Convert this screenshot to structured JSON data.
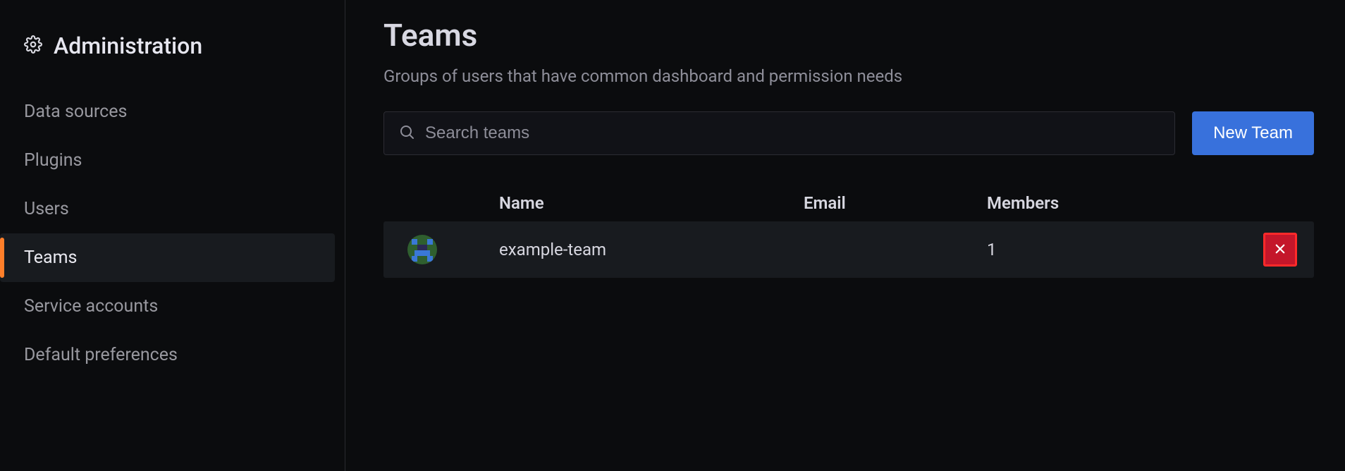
{
  "sidebar": {
    "title": "Administration",
    "items": [
      {
        "label": "Data sources",
        "active": false
      },
      {
        "label": "Plugins",
        "active": false
      },
      {
        "label": "Users",
        "active": false
      },
      {
        "label": "Teams",
        "active": true
      },
      {
        "label": "Service accounts",
        "active": false
      },
      {
        "label": "Default preferences",
        "active": false
      }
    ]
  },
  "page": {
    "title": "Teams",
    "subtitle": "Groups of users that have common dashboard and permission needs"
  },
  "search": {
    "placeholder": "Search teams",
    "value": ""
  },
  "buttons": {
    "new_team": "New Team"
  },
  "table": {
    "headers": {
      "name": "Name",
      "email": "Email",
      "members": "Members"
    },
    "rows": [
      {
        "name": "example-team",
        "email": "",
        "members": "1"
      }
    ]
  }
}
